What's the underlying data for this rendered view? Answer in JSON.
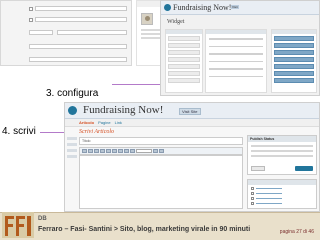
{
  "steps": {
    "configura": "3. configura",
    "scrivi": "4. scrivi"
  },
  "widgets_shot": {
    "app_title": "Fundraising Now!",
    "badge": "Visit",
    "heading": "Widget"
  },
  "editor_shot": {
    "app_title": "Fundraising Now!",
    "home_button": "Visit Site",
    "nav_items": [
      "Articolo",
      "Pagine",
      "Link"
    ],
    "heading": "Scrivi Articolo",
    "title_label": "Titolo",
    "publish_label": "Publish Status"
  },
  "footer": {
    "org": "DB",
    "text": "Ferraro – Fasi- Santini > Sito, blog, marketing virale in 90 minuti",
    "page": "pagina 27 di 46"
  },
  "colors": {
    "wp_blue": "#21759b",
    "accent_orange": "#d54e21",
    "footer_bg": "#e9e0cb",
    "arrow": "#b37ac9"
  }
}
